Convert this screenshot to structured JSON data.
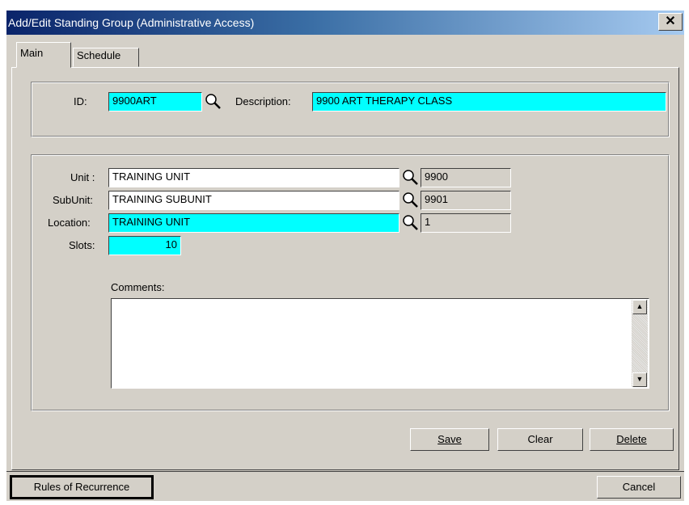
{
  "window": {
    "title": "Add/Edit Standing Group (Administrative Access)",
    "close_label": "✕"
  },
  "tabs": [
    {
      "label": "Main",
      "selected": true
    },
    {
      "label": "Schedule",
      "selected": false
    }
  ],
  "header_group": {
    "id_label": "ID:",
    "id_value": "9900ART",
    "description_label": "Description:",
    "description_value": "9900 ART THERAPY CLASS"
  },
  "details_group": {
    "unit_label": "Unit :",
    "unit_value": "TRAINING UNIT",
    "unit_code": "9900",
    "subunit_label": "SubUnit:",
    "subunit_value": "TRAINING SUBUNIT",
    "subunit_code": "9901",
    "location_label": "Location:",
    "location_value": "TRAINING UNIT",
    "location_code": "1",
    "slots_label": "Slots:",
    "slots_value": "10",
    "comments_label": "Comments:",
    "comments_value": ""
  },
  "buttons": {
    "save": "Save",
    "clear": "Clear",
    "delete": "Delete",
    "rules": "Rules of Recurrence",
    "cancel": "Cancel"
  },
  "icons": {
    "lookup": "magnifier-icon",
    "close": "close-icon",
    "scroll_up": "up-arrow-icon",
    "scroll_down": "down-arrow-icon"
  },
  "colors": {
    "required_field": "#00ffff",
    "titlebar_start": "#0a246a",
    "titlebar_end": "#a6caf0",
    "face": "#d4d0c8"
  }
}
